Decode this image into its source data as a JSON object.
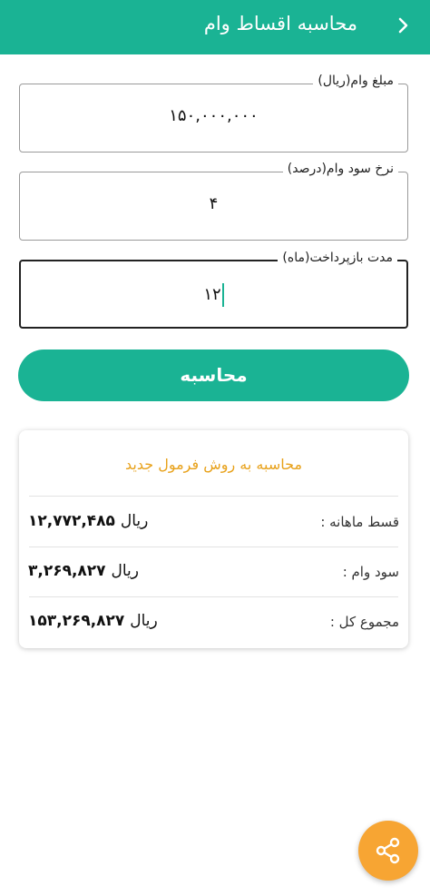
{
  "header": {
    "title": "محاسبه اقساط وام",
    "back_icon": "chevron-right-icon"
  },
  "form": {
    "loan_amount": {
      "label": "مبلغ وام(ریال)",
      "value": "۱۵۰,۰۰۰,۰۰۰"
    },
    "interest_rate": {
      "label": "نرخ سود وام(درصد)",
      "value": "۴"
    },
    "duration": {
      "label": "مدت بازپرداخت(ماه)",
      "value": "۱۲"
    }
  },
  "calculate_button": {
    "label": "محاسبه"
  },
  "result": {
    "title": "محاسبه به روش فرمول جدید",
    "rows": [
      {
        "label": "قسط ماهانه :",
        "value": "۱۲,۷۷۲,۴۸۵",
        "unit": "ریال"
      },
      {
        "label": "سود وام :",
        "value": "۳,۲۶۹,۸۲۷",
        "unit": "ریال"
      },
      {
        "label": "مجموع کل :",
        "value": "۱۵۳,۲۶۹,۸۲۷",
        "unit": "ریال"
      }
    ]
  },
  "fab": {
    "icon": "share-icon"
  },
  "colors": {
    "primary": "#1ab394",
    "accent": "#f7a533",
    "result_title": "#e8a21c"
  }
}
